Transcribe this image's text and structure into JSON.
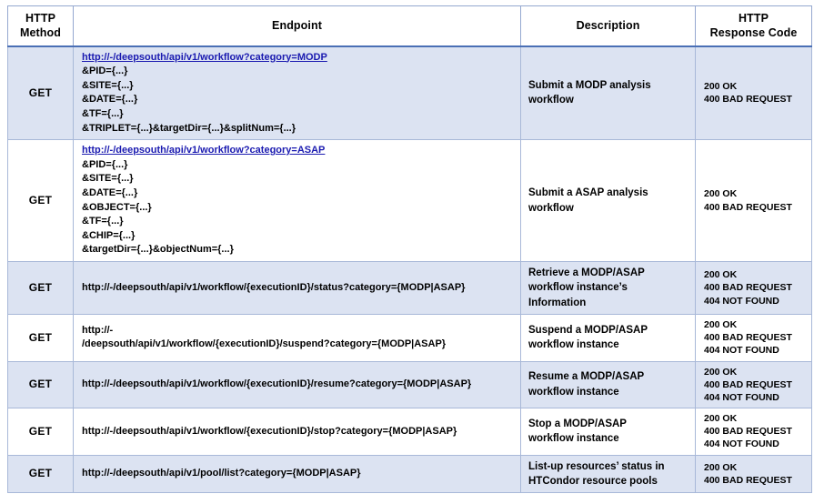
{
  "table": {
    "headers": [
      {
        "id": "http-method",
        "lines": [
          "HTTP",
          "Method"
        ]
      },
      {
        "id": "endpoint",
        "lines": [
          "Endpoint"
        ]
      },
      {
        "id": "description",
        "lines": [
          "Description"
        ]
      },
      {
        "id": "http-response-code",
        "lines": [
          "HTTP",
          "Response Code"
        ]
      }
    ],
    "rows": [
      {
        "shaded": true,
        "method": "GET",
        "endpoint": {
          "link": "http://-/deepsouth/api/v1/workflow?category=MODP",
          "params": [
            "&PID={...}",
            "&SITE={...}",
            "&DATE={...}",
            "&TF={...}",
            "&TRIPLET={...}&targetDir={...}&splitNum={...}"
          ],
          "plain": []
        },
        "description": [
          "Submit a MODP analysis",
          "workflow"
        ],
        "codes": [
          "200 OK",
          "400 BAD REQUEST"
        ]
      },
      {
        "shaded": false,
        "method": "GET",
        "endpoint": {
          "link": "http://-/deepsouth/api/v1/workflow?category=ASAP",
          "params": [
            "&PID={...}",
            "&SITE={...}",
            "&DATE={...}",
            "&OBJECT={...}",
            "&TF={...}",
            "&CHIP={...}",
            "&targetDir={...}&objectNum={...}"
          ],
          "plain": []
        },
        "description": [
          "Submit a ASAP analysis",
          "workflow"
        ],
        "codes": [
          "200 OK",
          "400 BAD REQUEST"
        ]
      },
      {
        "shaded": true,
        "method": "GET",
        "endpoint": {
          "link": "",
          "params": [],
          "plain": [
            "http://-/deepsouth/api/v1/workflow/{executionID}/status?category={MODP|ASAP}"
          ]
        },
        "description": [
          "Retrieve a MODP/ASAP",
          "workflow instance’s",
          "Information"
        ],
        "codes": [
          "200 OK",
          "400 BAD REQUEST",
          "404 NOT FOUND"
        ]
      },
      {
        "shaded": false,
        "method": "GET",
        "endpoint": {
          "link": "",
          "params": [],
          "plain": [
            "http://-",
            "/deepsouth/api/v1/workflow/{executionID}/suspend?category={MODP|ASAP}"
          ]
        },
        "description": [
          "Suspend a MODP/ASAP",
          "workflow instance"
        ],
        "codes": [
          "200 OK",
          "400 BAD REQUEST",
          "404 NOT FOUND"
        ]
      },
      {
        "shaded": true,
        "method": "GET",
        "endpoint": {
          "link": "",
          "params": [],
          "plain": [
            "http://-/deepsouth/api/v1/workflow/{executionID}/resume?category={MODP|ASAP}"
          ]
        },
        "description": [
          "Resume a MODP/ASAP",
          "workflow instance"
        ],
        "codes": [
          "200 OK",
          "400 BAD REQUEST",
          "404 NOT FOUND"
        ]
      },
      {
        "shaded": false,
        "method": "GET",
        "endpoint": {
          "link": "",
          "params": [],
          "plain": [
            "http://-/deepsouth/api/v1/workflow/{executionID}/stop?category={MODP|ASAP}"
          ]
        },
        "description": [
          "Stop a MODP/ASAP",
          "workflow instance"
        ],
        "codes": [
          "200 OK",
          "400 BAD REQUEST",
          "404 NOT FOUND"
        ]
      },
      {
        "shaded": true,
        "method": "GET",
        "endpoint": {
          "link": "",
          "params": [],
          "plain": [
            "http://-/deepsouth/api/v1/pool/list?category={MODP|ASAP}"
          ]
        },
        "description": [
          "List-up resources’ status in",
          "HTCondor resource pools"
        ],
        "codes": [
          "200 OK",
          "400 BAD REQUEST"
        ]
      }
    ]
  },
  "colors": {
    "shaded_row": "#dce3f2",
    "plain_row": "#ffffff",
    "cell_border": "#a8b8d8",
    "header_underline": "#4a6fb5",
    "link_text": "#1a1ab0"
  }
}
